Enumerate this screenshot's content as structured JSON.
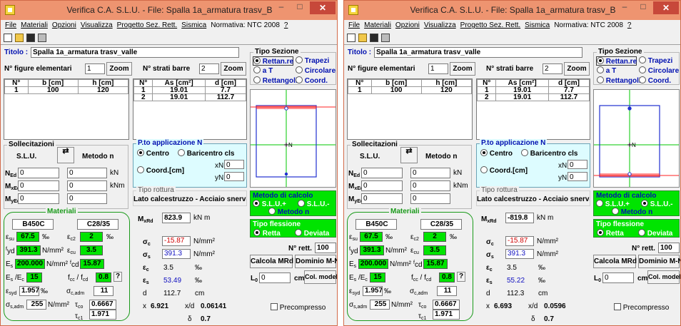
{
  "colors": {
    "titlebar": "#ee9470",
    "close": "#c7483a",
    "green": "#00e400",
    "cyan_panel": "#ddfcff",
    "section_red": "#ff2020",
    "section_blue": "#2030d0"
  },
  "menu": [
    "File",
    "Materiali",
    "Opzioni",
    "Visualizza",
    "Progetto Sez. Rett.",
    "Sismica",
    "Normativa: NTC 2008",
    "?"
  ],
  "toolbar_icons": [
    "new-file-icon",
    "open-folder-icon",
    "save-disk-icon",
    "print-icon"
  ],
  "common": {
    "titolo_label": "Titolo :",
    "titolo_value": "Spalla 1a_armatura trasv_valle",
    "n_figure_label": "N° figure elementari",
    "n_figure_value": "1",
    "zoom": "Zoom",
    "n_strati_label": "N° strati barre",
    "n_strati_value": "2",
    "table1_headers": [
      "N°",
      "b [cm]",
      "h [cm]"
    ],
    "table1_rows": [
      [
        "1",
        "100",
        "120"
      ]
    ],
    "table2_headers": [
      "N°",
      "As [cm²]",
      "d [cm]"
    ],
    "tipo_sezione_label": "Tipo Sezione",
    "sezione_options": [
      "Rettan.re",
      "Trapezi",
      "a T",
      "Circolare",
      "Rettangoli",
      "Coord."
    ],
    "sollecitazioni_label": "Sollecitazioni",
    "slu_label": "S.L.U.",
    "metodo_n_label": "Metodo n",
    "ned_value": "0",
    "mxed_value": "0",
    "myed_value": "0",
    "c1_values": [
      "0",
      "0",
      "0"
    ],
    "unit_kn": "kN",
    "unit_knm": "kNm",
    "p_app_label": "P.to applicazione N",
    "centro": "Centro",
    "baricentro": "Baricentro cls",
    "coord_cm": "Coord.[cm]",
    "xn_label": "xN",
    "yn_label": "yN",
    "xn_value": "0",
    "yn_value": "0",
    "tipo_rottura_label": "Tipo rottura",
    "tipo_rottura_value": "Lato calcestruzzo - Acciaio snervato",
    "materiali_label": "Materiali",
    "steel": "B450C",
    "concrete": "C28/35",
    "esu": "67.5",
    "ec2": "2",
    "fyd": "391.3",
    "ecu": "3.5",
    "es": "200.000",
    "fcd": "15.87",
    "esec": "15",
    "fccfcd": "0.8",
    "esyd": "1.957",
    "sc_adm": "11",
    "ss_adm": "255",
    "tco": "0.6667",
    "tc1": "1.971",
    "unit_permille": "‰",
    "unit_nmm2": "N/mm²",
    "mrd_unit": "kN m",
    "sigma_c": "-15.87",
    "sigma_s": "391.3",
    "eps_c": "3.5",
    "unit_cm": "cm",
    "delta": "0.7",
    "metodo_calcolo_label": "Metodo di calcolo",
    "slu_plus": "S.L.U.+",
    "slu_minus": "S.L.U.-",
    "metodo_n_radio": "Metodo n",
    "tipo_flessione_label": "Tipo flessione",
    "retta": "Retta",
    "deviata": "Deviata",
    "n_rett_label": "N° rett.",
    "n_rett_value": "100",
    "calcola_mrd": "Calcola MRd",
    "dominio": "Dominio M-N",
    "l0_label": "L",
    "l0_value": "0",
    "col_modello": "Col. modello",
    "precompresso": "Precompresso",
    "qmark": "?"
  },
  "windows": [
    {
      "title": "Verifica C.A. S.L.U. - File: Spalla 1a_armatura trasv_B",
      "bars": [
        [
          "1",
          "19.01",
          "7.7"
        ],
        [
          "2",
          "19.01",
          "112.7"
        ]
      ],
      "mrd": "823.9",
      "eps_s": "53.49",
      "d": "112.7",
      "x": "6.921",
      "x_over_d": "0.06141",
      "slu_selected": "plus"
    },
    {
      "title": "Verifica C.A. S.L.U. - File: Spalla 1a_armatura trasv_B",
      "bars": [
        [
          "1",
          "19.01",
          "7.7"
        ],
        [
          "2",
          "19.01",
          "112.7"
        ]
      ],
      "mrd": "-819.8",
      "eps_s": "55.22",
      "d": "112.3",
      "x": "6.693",
      "x_over_d": "0.0596",
      "slu_selected": "minus"
    }
  ]
}
